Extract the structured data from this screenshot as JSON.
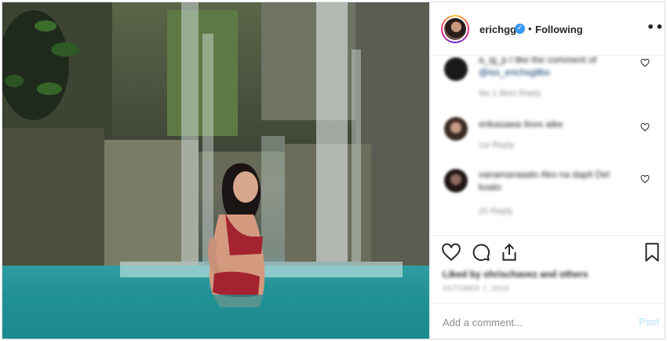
{
  "header": {
    "username": "erichgg",
    "verified_icon": "✓",
    "separator": "•",
    "follow_status": "Following",
    "more_icon": "•••"
  },
  "comments": [
    {
      "line1": "a_ig_p I like the comment of",
      "line2": "@iss_erichsgilbo",
      "meta": "9w   1 likes   Reply"
    },
    {
      "line1": "erikasawa Ilovs aike",
      "meta": "1w   Reply"
    },
    {
      "line1": "vanamaraaalo Ako na dapit Del",
      "line2": "koalo",
      "meta": "2h   Reply"
    }
  ],
  "actions": {
    "likes_text": "Liked by shrischavez and others",
    "date_text": "OCTOBER 7, 2019"
  },
  "add_comment": {
    "placeholder": "Add a comment...",
    "post_label": "Post"
  }
}
